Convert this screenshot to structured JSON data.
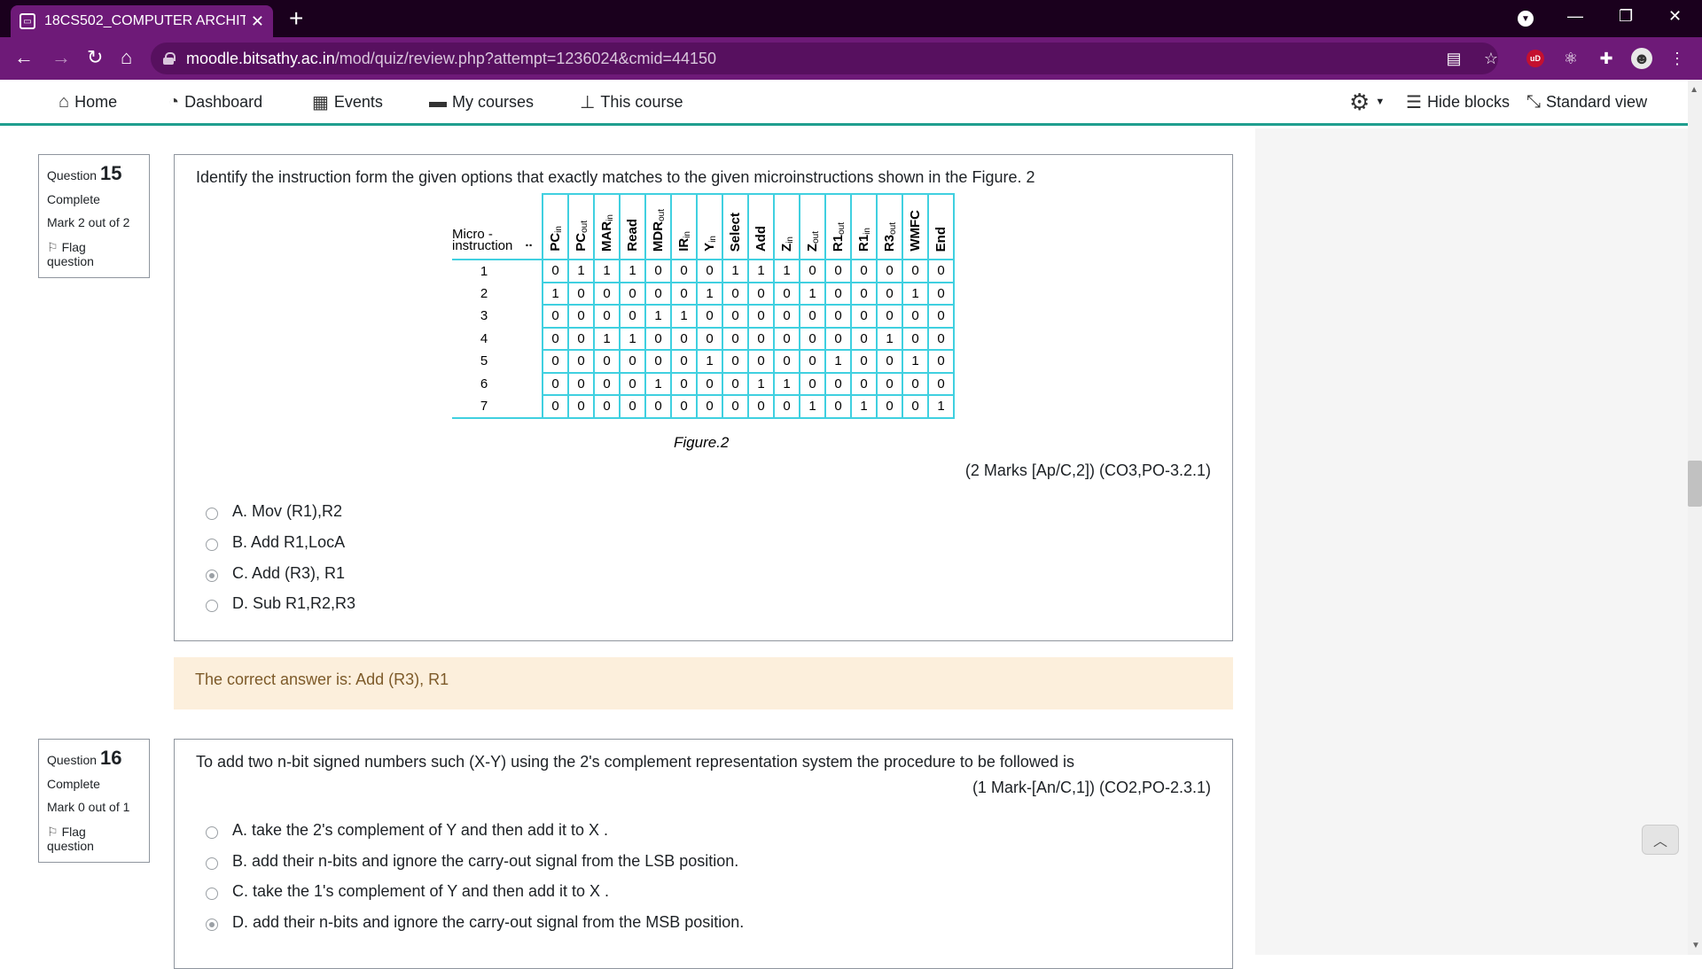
{
  "browser": {
    "tab_title": "18CS502_COMPUTER ARCHITECT",
    "tab_close": "✕",
    "new_tab": "+",
    "url_host": "moodle.bitsathy.ac.in",
    "url_path": "/mod/quiz/review.php?attempt=1236024&cmid=44150",
    "ublock_label": "uD"
  },
  "nav": {
    "home": "Home",
    "dashboard": "Dashboard",
    "events": "Events",
    "my_courses": "My courses",
    "this_course": "This course",
    "hide_blocks": "Hide blocks",
    "standard_view": "Standard view"
  },
  "q15": {
    "label": "Question",
    "number": "15",
    "state": "Complete",
    "grade": "Mark 2 out of 2",
    "flag_line1": "Flag",
    "flag_line2": "question",
    "text": "Identify the instruction form the given options that exactly matches to the given microinstructions shown in the Figure. 2",
    "marks": "(2 Marks [Ap/C,2]) (CO3,PO-3.2.1)",
    "options": [
      {
        "label": "A. Mov (R1),R2",
        "checked": false
      },
      {
        "label": "B. Add R1,LocA",
        "checked": false
      },
      {
        "label": "C. Add (R3), R1",
        "checked": true
      },
      {
        "label": "D. Sub R1,R2,R3",
        "checked": false
      }
    ],
    "feedback": "The correct answer is: Add (R3), R1",
    "figure": {
      "header_mi_line1": "Micro -",
      "header_mi_line2": "instruction",
      "header_dots": "..",
      "caption": "Figure.2",
      "rows": [
        {
          "n": "1",
          "v": [
            "0",
            "1",
            "1",
            "1",
            "0",
            "0",
            "0",
            "1",
            "1",
            "1",
            "0",
            "0",
            "0",
            "0",
            "0",
            "0"
          ]
        },
        {
          "n": "2",
          "v": [
            "1",
            "0",
            "0",
            "0",
            "0",
            "0",
            "1",
            "0",
            "0",
            "0",
            "1",
            "0",
            "0",
            "0",
            "1",
            "0"
          ]
        },
        {
          "n": "3",
          "v": [
            "0",
            "0",
            "0",
            "0",
            "1",
            "1",
            "0",
            "0",
            "0",
            "0",
            "0",
            "0",
            "0",
            "0",
            "0",
            "0"
          ]
        },
        {
          "n": "4",
          "v": [
            "0",
            "0",
            "1",
            "1",
            "0",
            "0",
            "0",
            "0",
            "0",
            "0",
            "0",
            "0",
            "0",
            "1",
            "0",
            "0"
          ]
        },
        {
          "n": "5",
          "v": [
            "0",
            "0",
            "0",
            "0",
            "0",
            "0",
            "1",
            "0",
            "0",
            "0",
            "0",
            "1",
            "0",
            "0",
            "1",
            "0"
          ]
        },
        {
          "n": "6",
          "v": [
            "0",
            "0",
            "0",
            "0",
            "1",
            "0",
            "0",
            "0",
            "1",
            "1",
            "0",
            "0",
            "0",
            "0",
            "0",
            "0"
          ]
        },
        {
          "n": "7",
          "v": [
            "0",
            "0",
            "0",
            "0",
            "0",
            "0",
            "0",
            "0",
            "0",
            "0",
            "1",
            "0",
            "1",
            "0",
            "0",
            "1"
          ]
        }
      ]
    }
  },
  "q16": {
    "label": "Question",
    "number": "16",
    "state": "Complete",
    "grade": "Mark 0 out of 1",
    "flag_line1": "Flag",
    "flag_line2": "question",
    "text": "To add two n-bit signed numbers such (X-Y) using the 2's complement representation system the procedure to be followed is",
    "marks": "(1 Mark-[An/C,1]) (CO2,PO-2.3.1)",
    "options": [
      {
        "label": "A. take the 2's complement of Y and then add it to X .",
        "checked": false
      },
      {
        "label": "B. add their n-bits and ignore the carry-out signal from the LSB position.",
        "checked": false
      },
      {
        "label": "C. take the 1's complement of Y and then add it to X .",
        "checked": false
      },
      {
        "label": "D. add their n-bits and ignore the carry-out signal from the MSB position.",
        "checked": true
      }
    ]
  }
}
